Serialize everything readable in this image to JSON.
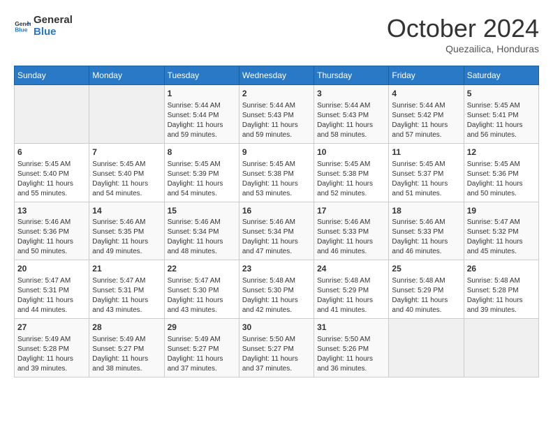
{
  "header": {
    "logo_line1": "General",
    "logo_line2": "Blue",
    "month": "October 2024",
    "location": "Quezailica, Honduras"
  },
  "weekdays": [
    "Sunday",
    "Monday",
    "Tuesday",
    "Wednesday",
    "Thursday",
    "Friday",
    "Saturday"
  ],
  "weeks": [
    [
      {
        "day": "",
        "info": ""
      },
      {
        "day": "",
        "info": ""
      },
      {
        "day": "1",
        "info": "Sunrise: 5:44 AM\nSunset: 5:44 PM\nDaylight: 11 hours and 59 minutes."
      },
      {
        "day": "2",
        "info": "Sunrise: 5:44 AM\nSunset: 5:43 PM\nDaylight: 11 hours and 59 minutes."
      },
      {
        "day": "3",
        "info": "Sunrise: 5:44 AM\nSunset: 5:43 PM\nDaylight: 11 hours and 58 minutes."
      },
      {
        "day": "4",
        "info": "Sunrise: 5:44 AM\nSunset: 5:42 PM\nDaylight: 11 hours and 57 minutes."
      },
      {
        "day": "5",
        "info": "Sunrise: 5:45 AM\nSunset: 5:41 PM\nDaylight: 11 hours and 56 minutes."
      }
    ],
    [
      {
        "day": "6",
        "info": "Sunrise: 5:45 AM\nSunset: 5:40 PM\nDaylight: 11 hours and 55 minutes."
      },
      {
        "day": "7",
        "info": "Sunrise: 5:45 AM\nSunset: 5:40 PM\nDaylight: 11 hours and 54 minutes."
      },
      {
        "day": "8",
        "info": "Sunrise: 5:45 AM\nSunset: 5:39 PM\nDaylight: 11 hours and 54 minutes."
      },
      {
        "day": "9",
        "info": "Sunrise: 5:45 AM\nSunset: 5:38 PM\nDaylight: 11 hours and 53 minutes."
      },
      {
        "day": "10",
        "info": "Sunrise: 5:45 AM\nSunset: 5:38 PM\nDaylight: 11 hours and 52 minutes."
      },
      {
        "day": "11",
        "info": "Sunrise: 5:45 AM\nSunset: 5:37 PM\nDaylight: 11 hours and 51 minutes."
      },
      {
        "day": "12",
        "info": "Sunrise: 5:45 AM\nSunset: 5:36 PM\nDaylight: 11 hours and 50 minutes."
      }
    ],
    [
      {
        "day": "13",
        "info": "Sunrise: 5:46 AM\nSunset: 5:36 PM\nDaylight: 11 hours and 50 minutes."
      },
      {
        "day": "14",
        "info": "Sunrise: 5:46 AM\nSunset: 5:35 PM\nDaylight: 11 hours and 49 minutes."
      },
      {
        "day": "15",
        "info": "Sunrise: 5:46 AM\nSunset: 5:34 PM\nDaylight: 11 hours and 48 minutes."
      },
      {
        "day": "16",
        "info": "Sunrise: 5:46 AM\nSunset: 5:34 PM\nDaylight: 11 hours and 47 minutes."
      },
      {
        "day": "17",
        "info": "Sunrise: 5:46 AM\nSunset: 5:33 PM\nDaylight: 11 hours and 46 minutes."
      },
      {
        "day": "18",
        "info": "Sunrise: 5:46 AM\nSunset: 5:33 PM\nDaylight: 11 hours and 46 minutes."
      },
      {
        "day": "19",
        "info": "Sunrise: 5:47 AM\nSunset: 5:32 PM\nDaylight: 11 hours and 45 minutes."
      }
    ],
    [
      {
        "day": "20",
        "info": "Sunrise: 5:47 AM\nSunset: 5:31 PM\nDaylight: 11 hours and 44 minutes."
      },
      {
        "day": "21",
        "info": "Sunrise: 5:47 AM\nSunset: 5:31 PM\nDaylight: 11 hours and 43 minutes."
      },
      {
        "day": "22",
        "info": "Sunrise: 5:47 AM\nSunset: 5:30 PM\nDaylight: 11 hours and 43 minutes."
      },
      {
        "day": "23",
        "info": "Sunrise: 5:48 AM\nSunset: 5:30 PM\nDaylight: 11 hours and 42 minutes."
      },
      {
        "day": "24",
        "info": "Sunrise: 5:48 AM\nSunset: 5:29 PM\nDaylight: 11 hours and 41 minutes."
      },
      {
        "day": "25",
        "info": "Sunrise: 5:48 AM\nSunset: 5:29 PM\nDaylight: 11 hours and 40 minutes."
      },
      {
        "day": "26",
        "info": "Sunrise: 5:48 AM\nSunset: 5:28 PM\nDaylight: 11 hours and 39 minutes."
      }
    ],
    [
      {
        "day": "27",
        "info": "Sunrise: 5:49 AM\nSunset: 5:28 PM\nDaylight: 11 hours and 39 minutes."
      },
      {
        "day": "28",
        "info": "Sunrise: 5:49 AM\nSunset: 5:27 PM\nDaylight: 11 hours and 38 minutes."
      },
      {
        "day": "29",
        "info": "Sunrise: 5:49 AM\nSunset: 5:27 PM\nDaylight: 11 hours and 37 minutes."
      },
      {
        "day": "30",
        "info": "Sunrise: 5:50 AM\nSunset: 5:27 PM\nDaylight: 11 hours and 37 minutes."
      },
      {
        "day": "31",
        "info": "Sunrise: 5:50 AM\nSunset: 5:26 PM\nDaylight: 11 hours and 36 minutes."
      },
      {
        "day": "",
        "info": ""
      },
      {
        "day": "",
        "info": ""
      }
    ]
  ]
}
